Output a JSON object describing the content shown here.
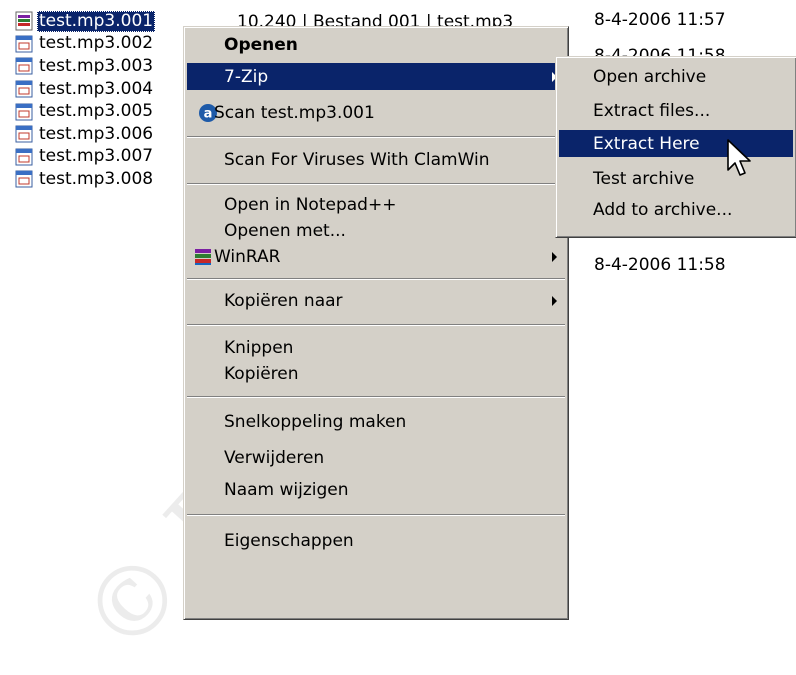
{
  "files": [
    {
      "name": "test.mp3.001",
      "selected": true,
      "icon": "winrar-archive-icon"
    },
    {
      "name": "test.mp3.002",
      "icon": "file-icon"
    },
    {
      "name": "test.mp3.003",
      "icon": "file-icon"
    },
    {
      "name": "test.mp3.004",
      "icon": "file-icon"
    },
    {
      "name": "test.mp3.005",
      "icon": "file-icon"
    },
    {
      "name": "test.mp3.006",
      "icon": "file-icon"
    },
    {
      "name": "test.mp3.007",
      "icon": "file-icon"
    },
    {
      "name": "test.mp3.008",
      "icon": "file-icon"
    }
  ],
  "row1_partial_text": "10.240 | Bestand 001 | test.mp3",
  "dates": {
    "row1": "8-4-2006 11:57",
    "row2_partial": "8-4-2006 11:58",
    "row8": "8-4-2006 11:58"
  },
  "context_menu": {
    "open": "Openen",
    "sevenzip": "7-Zip",
    "scan": "Scan test.mp3.001",
    "clamwin": "Scan For Viruses With ClamWin",
    "notepad": "Open in Notepad++",
    "open_with": "Openen met...",
    "winrar": "WinRAR",
    "copy_to": "Kopiëren naar",
    "cut": "Knippen",
    "copy": "Kopiëren",
    "shortcut": "Snelkoppeling maken",
    "delete": "Verwijderen",
    "rename": "Naam wijzigen",
    "properties": "Eigenschappen"
  },
  "submenu_7zip": {
    "open_archive": "Open archive",
    "extract_files": "Extract files...",
    "extract_here": "Extract Here",
    "test_archive": "Test archive",
    "add_to_archive": "Add to archive..."
  },
  "watermark": "© BinariesAll",
  "colors": {
    "highlight": "#0a246a",
    "menu_bg": "#d4d0c8"
  }
}
